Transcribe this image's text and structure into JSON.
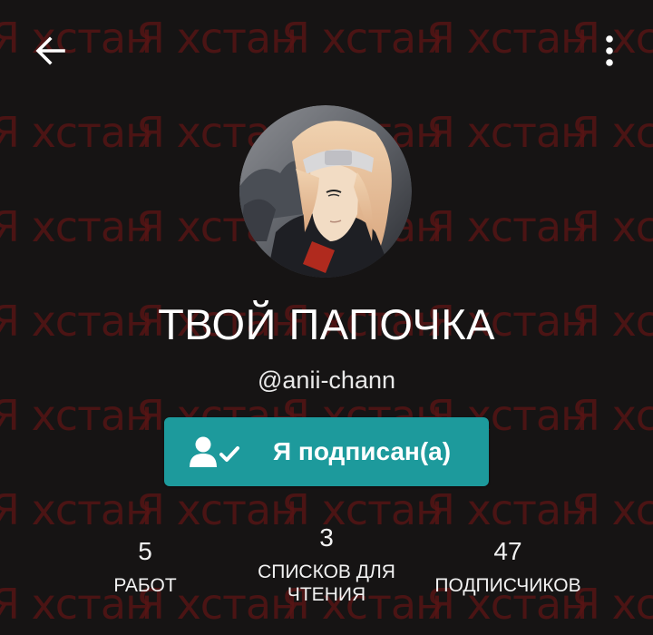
{
  "header": {
    "back_icon": "arrow-left-icon",
    "menu_icon": "more-vertical-icon"
  },
  "background": {
    "watermark_text": "Я хстан",
    "watermark_color": "#5a1414",
    "base_color": "#161414"
  },
  "profile": {
    "avatar_icon": "avatar-image",
    "display_name": "ТВОЙ ПАПОЧКА",
    "username": "@anii-chann"
  },
  "follow_button": {
    "label": "Я подписан(а)",
    "icon": "user-check-icon",
    "color": "#1d9a9c"
  },
  "stats": [
    {
      "value": "5",
      "label": "РАБОТ"
    },
    {
      "value": "3",
      "label": "СПИСКОВ ДЛЯ ЧТЕНИЯ"
    },
    {
      "value": "47",
      "label": "ПОДПИСЧИКОВ"
    }
  ]
}
